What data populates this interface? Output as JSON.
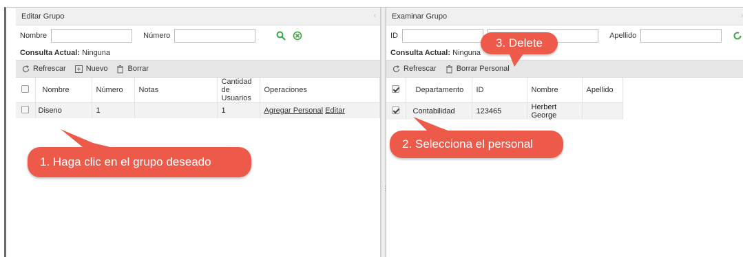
{
  "left_panel": {
    "title": "Editar Grupo",
    "search": {
      "name_label": "Nombre",
      "number_label": "Número",
      "name_value": "",
      "number_value": ""
    },
    "query_label": "Consulta Actual:",
    "query_value": "Ninguna",
    "toolbar": {
      "refresh": "Refrescar",
      "new": "Nuevo",
      "delete": "Borrar"
    },
    "columns": {
      "name": "Nombre",
      "number": "Número",
      "notes": "Notas",
      "user_count_line1": "Cantidad de",
      "user_count_line2": "Usuarios",
      "operations": "Operaciones"
    },
    "rows": [
      {
        "name": "Diseno",
        "number": "1",
        "notes": "",
        "user_count": "1",
        "add_link": "Agregar Personal",
        "edit_link": "Editar"
      }
    ]
  },
  "right_panel": {
    "title": "Examinar Grupo",
    "search": {
      "id_label": "ID",
      "lastname_label": "Apellido",
      "id_value": "",
      "lastname_value": ""
    },
    "query_label": "Consulta Actual:",
    "query_value": "Ninguna",
    "toolbar": {
      "refresh": "Refrescar",
      "delete_personnel": "Borrar Personal"
    },
    "columns": {
      "department": "Departamento",
      "id": "ID",
      "name": "Nombre",
      "lastname": "Apellido"
    },
    "rows": [
      {
        "department": "Contabilidad",
        "id": "123465",
        "name": "Herbert George",
        "lastname": ""
      }
    ]
  },
  "callouts": {
    "step1": "1. Haga clic en el grupo deseado",
    "step2": "2. Selecciona el personal",
    "step3": "3. Delete"
  },
  "colors": {
    "callout": "#ee5a4a",
    "accent_green": "#3aa845"
  },
  "icons": {
    "search": "search-icon",
    "clear": "clear-circle-x-icon",
    "refresh": "refresh-icon",
    "new": "new-record-icon",
    "delete": "trash-icon",
    "collapse": "chevron-left-icon"
  }
}
